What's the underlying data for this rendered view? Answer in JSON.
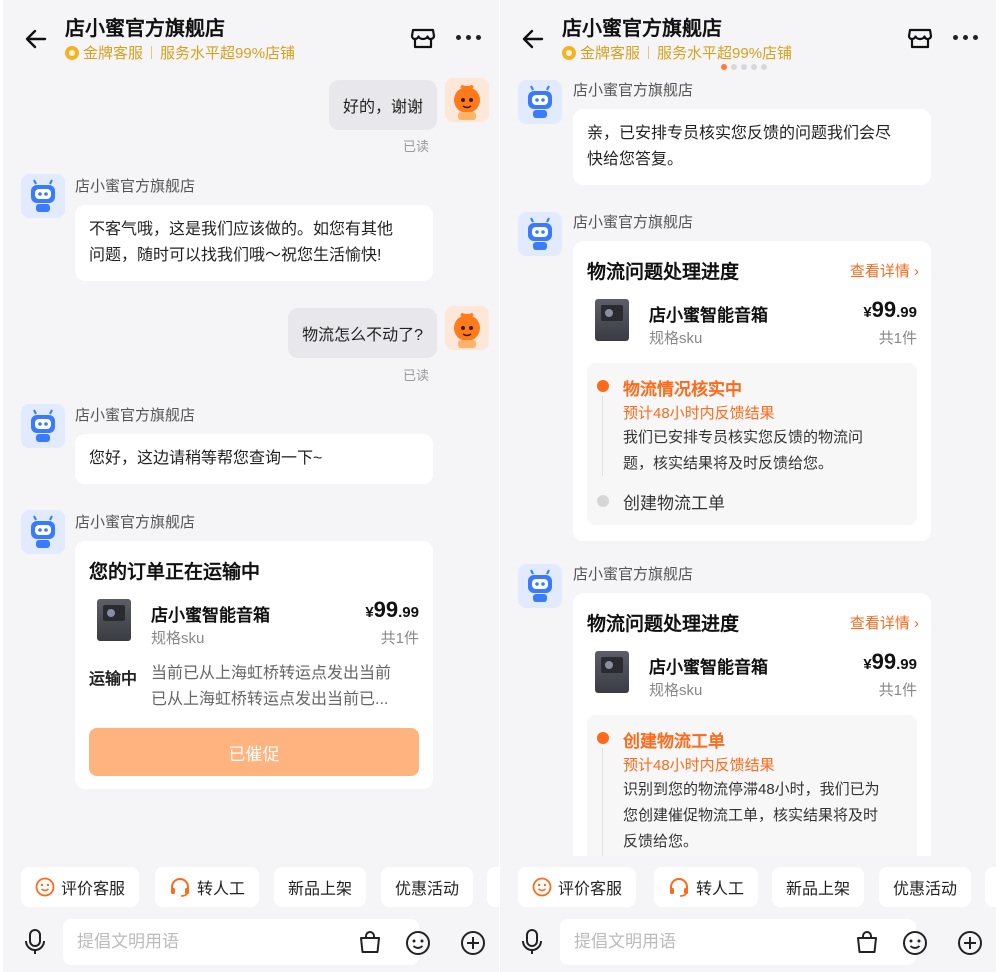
{
  "header": {
    "title": "店小蜜官方旗舰店",
    "badge": "金牌客服",
    "service_level": "服务水平超99%店铺"
  },
  "left": {
    "messages": {
      "user1_text": "好的，谢谢",
      "user1_read": "已读",
      "bot1_sender": "店小蜜官方旗舰店",
      "bot1_line1": "不客气哦，这是我们应该做的。如您有其他",
      "bot1_line2": "问题，随时可以找我们哦～祝您生活愉快!",
      "user2_text": "物流怎么不动了?",
      "user2_read": "已读",
      "bot2_sender": "店小蜜官方旗舰店",
      "bot2_text": "您好，这边请稍等帮您查询一下~",
      "bot3_sender": "店小蜜官方旗舰店"
    },
    "order_card": {
      "title": "您的订单正在运输中",
      "product_name": "店小蜜智能音箱",
      "spec": "规格sku",
      "currency": "¥",
      "price_int": "99",
      "price_dec": ".99",
      "qty": "共1件",
      "ship_label": "运输中",
      "ship_line1": "当前已从上海虹桥转运点发出当前",
      "ship_line2": "已从上海虹桥转运点发出当前已...",
      "button": "已催促"
    }
  },
  "right": {
    "messages": {
      "bot1_sender": "店小蜜官方旗舰店",
      "bot1_line1": "亲，已安排专员核实您反馈的问题我们会尽",
      "bot1_line2": "快给您答复。",
      "bot2_sender": "店小蜜官方旗舰店",
      "bot3_sender": "店小蜜官方旗舰店"
    },
    "card1": {
      "title": "物流问题处理进度",
      "detail": "查看详情",
      "product_name": "店小蜜智能音箱",
      "spec": "规格sku",
      "currency": "¥",
      "price_int": "99",
      "price_dec": ".99",
      "qty": "共1件",
      "step1_title": "物流情况核实中",
      "step1_sub": "预计48小时内反馈结果",
      "step1_line1": "我们已安排专员核实您反馈的物流问",
      "step1_line2": "题，核实结果将及时反馈给您。",
      "step2_title": "创建物流工单"
    },
    "card2": {
      "title": "物流问题处理进度",
      "detail": "查看详情",
      "product_name": "店小蜜智能音箱",
      "spec": "规格sku",
      "currency": "¥",
      "price_int": "99",
      "price_dec": ".99",
      "qty": "共1件",
      "step1_title": "创建物流工单",
      "step1_sub": "预计48小时内反馈结果",
      "step1_line1": "识别到您的物流停滞48小时，我们已为",
      "step1_line2": "您创建催促物流工单，核实结果将及时",
      "step1_line3": "反馈给您。"
    }
  },
  "quick_replies": [
    "评价客服",
    "转人工",
    "新品上架",
    "优惠活动"
  ],
  "input": {
    "placeholder": "提倡文明用语"
  },
  "icons": {
    "back": "back-arrow-icon",
    "store": "store-icon",
    "more": "more-icon",
    "smile": "smile-icon",
    "headset": "headset-icon",
    "voice": "microphone-icon",
    "bag": "bag-icon",
    "emoji": "emoji-icon",
    "add": "plus-circle-icon"
  },
  "colors": {
    "accent": "#ff6a1a",
    "gold": "#d6a11e",
    "button_disabled": "#ffb37e"
  }
}
